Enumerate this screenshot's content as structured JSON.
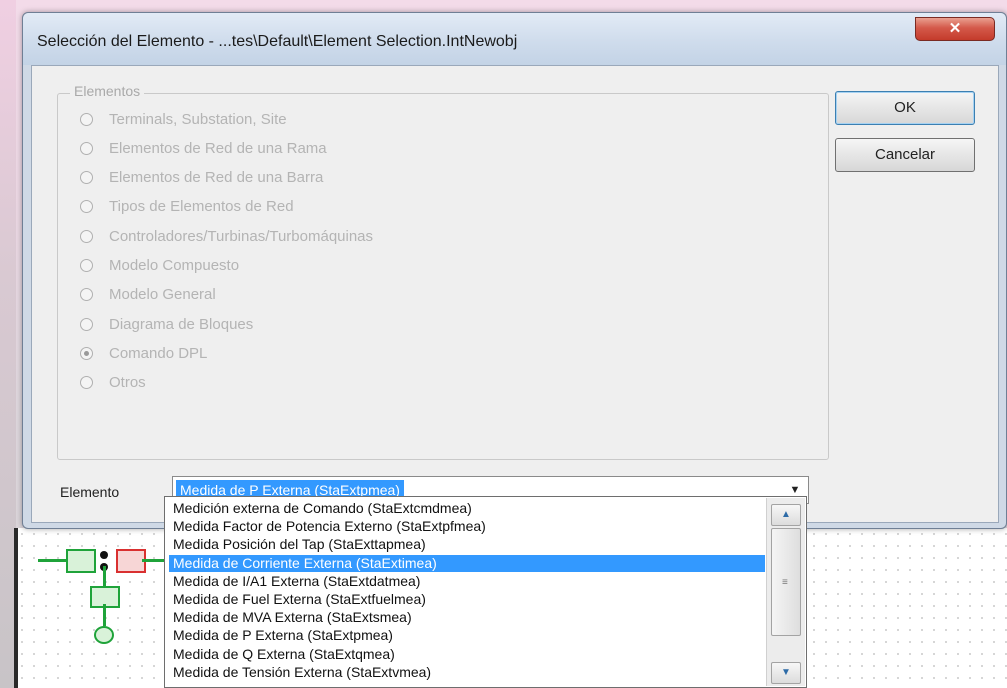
{
  "dialog": {
    "title": "Selección del Elemento - ...tes\\Default\\Element Selection.IntNewobj",
    "close_glyph": "✕",
    "ok_label": "OK",
    "cancel_label": "Cancelar"
  },
  "elementos_group": {
    "legend": "Elementos",
    "options": [
      {
        "label": "Terminals, Substation, Site",
        "checked": false
      },
      {
        "label": "Elementos de Red de una Rama",
        "checked": false
      },
      {
        "label": "Elementos de Red de una Barra",
        "checked": false
      },
      {
        "label": "Tipos de Elementos de Red",
        "checked": false
      },
      {
        "label": "Controladores/Turbinas/Turbomáquinas",
        "checked": false
      },
      {
        "label": "Modelo Compuesto",
        "checked": false
      },
      {
        "label": "Modelo General",
        "checked": false
      },
      {
        "label": "Diagrama de Bloques",
        "checked": false
      },
      {
        "label": "Comando DPL",
        "checked": true
      },
      {
        "label": "Otros",
        "checked": false
      }
    ]
  },
  "element_field": {
    "label": "Elemento",
    "value": "Medida de P Externa (StaExtpmea)",
    "arrow_glyph": "▼"
  },
  "dropdown": {
    "items": [
      {
        "label": "Medición externa de Comando (StaExtcmdmea)",
        "selected": false
      },
      {
        "label": "Medida Factor de Potencia Externo (StaExtpfmea)",
        "selected": false
      },
      {
        "label": "Medida Posición del Tap (StaExttapmea)",
        "selected": false
      },
      {
        "label": "Medida de Corriente Externa (StaExtimea)",
        "selected": true
      },
      {
        "label": "Medida de I/A1 Externa (StaExtdatmea)",
        "selected": false
      },
      {
        "label": "Medida de Fuel Externa (StaExtfuelmea)",
        "selected": false
      },
      {
        "label": "Medida de MVA Externa (StaExtsmea)",
        "selected": false
      },
      {
        "label": "Medida de P Externa (StaExtpmea)",
        "selected": false
      },
      {
        "label": "Medida de Q Externa (StaExtqmea)",
        "selected": false
      },
      {
        "label": "Medida de Tensión Externa (StaExtvmea)",
        "selected": false
      }
    ],
    "scroll_up_glyph": "▲",
    "scroll_down_glyph": "▼",
    "grip_glyph": "≡"
  },
  "colors": {
    "selection": "#3399ff",
    "disabled_text": "#b4b4b4",
    "close_button": "#c43b2b"
  }
}
